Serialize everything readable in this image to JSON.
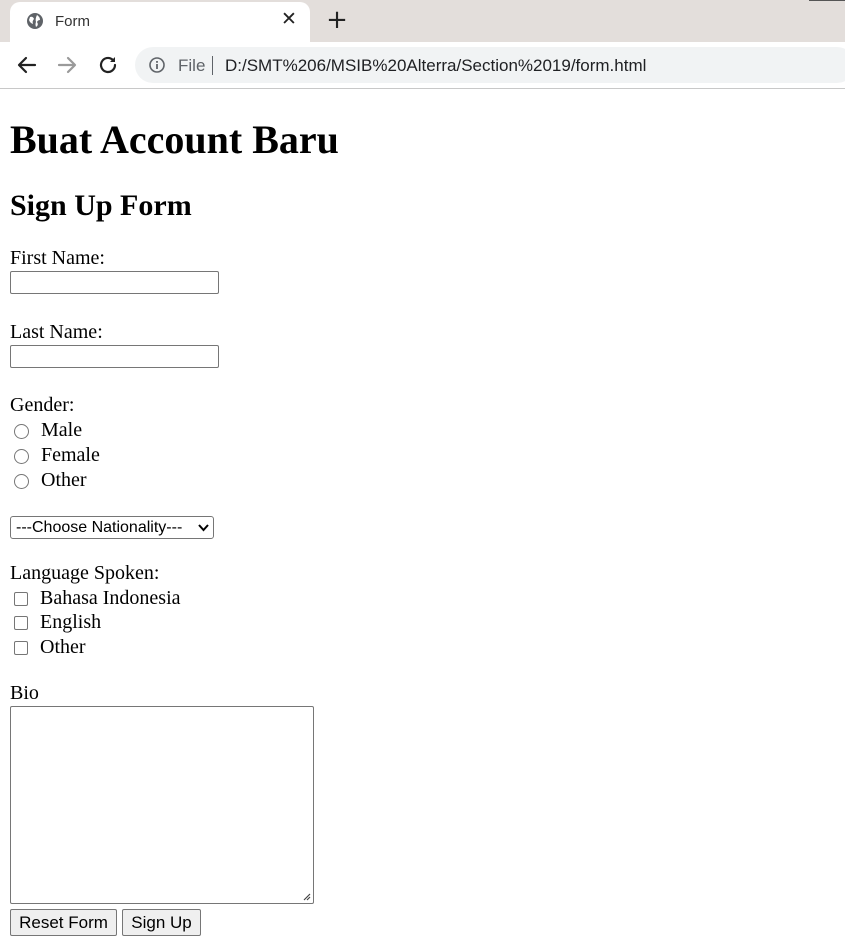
{
  "browser": {
    "tab_title": "Form",
    "scheme_label": "File",
    "url": "D:/SMT%206/MSIB%20Alterra/Section%2019/form.html"
  },
  "page": {
    "heading": "Buat Account Baru",
    "subheading": "Sign Up Form",
    "first_name_label": "First Name:",
    "first_name_value": "",
    "last_name_label": "Last Name:",
    "last_name_value": "",
    "gender_label": "Gender:",
    "gender_options": [
      "Male",
      "Female",
      "Other"
    ],
    "nationality_selected": "---Choose Nationality---",
    "language_label": "Language Spoken:",
    "language_options": [
      "Bahasa Indonesia",
      "English",
      "Other"
    ],
    "bio_label": "Bio",
    "bio_value": "",
    "reset_label": "Reset Form",
    "submit_label": "Sign Up"
  }
}
